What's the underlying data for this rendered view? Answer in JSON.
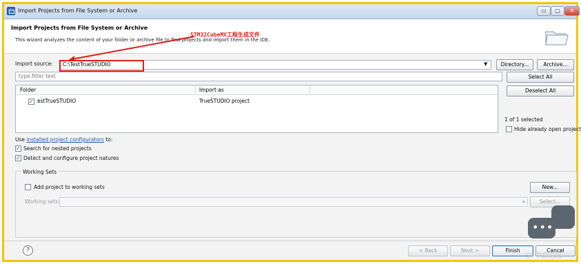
{
  "window": {
    "title": "Import Projects from File System or Archive",
    "controls": {
      "minimize": "▭",
      "maximize": "▢",
      "close": "✕"
    }
  },
  "header": {
    "title": "Import Projects from File System or Archive",
    "description": "This wizard analyzes the content of your folder or archive file to find projects and import them in the IDE."
  },
  "annotation": {
    "text": "STM32CubeMX工程生成文件",
    "color": "#e0201b"
  },
  "import_source": {
    "label": "Import source:",
    "value": "C:\\TestTrueSTUDIO"
  },
  "buttons": {
    "directory": "Directory...",
    "archive": "Archive...",
    "select_all": "Select All",
    "deselect_all": "Deselect All"
  },
  "filter": {
    "placeholder": "type filter text"
  },
  "table": {
    "columns": [
      "Folder",
      "Import as"
    ],
    "rows": [
      {
        "checked": true,
        "folder": "estTrueSTUDIO",
        "import_as": "TrueSTUDIO project"
      }
    ]
  },
  "selection_status": "1 of 1 selected",
  "hide_open": {
    "label": "Hide already open projects",
    "checked": false
  },
  "use_configurators": {
    "prefix": "Use",
    "link": "installed project configurators",
    "suffix": "to:"
  },
  "options": [
    {
      "label": "Search for nested projects",
      "checked": true
    },
    {
      "label": "Detect and configure project natures",
      "checked": true
    }
  ],
  "working_sets": {
    "title": "Working Sets",
    "add_label": "Add project to working sets",
    "add_checked": false,
    "sets_label": "Working sets:",
    "new_button": "New...",
    "select_button": "Select..."
  },
  "footer": {
    "help": "?",
    "back": "< Back",
    "next": "Next >",
    "finish": "Finish",
    "cancel": "Cancel"
  },
  "watermark": "ST中文论坛",
  "colors": {
    "frame": "#f5c400",
    "highlight": "#e01b1b",
    "link": "#2455b0"
  }
}
